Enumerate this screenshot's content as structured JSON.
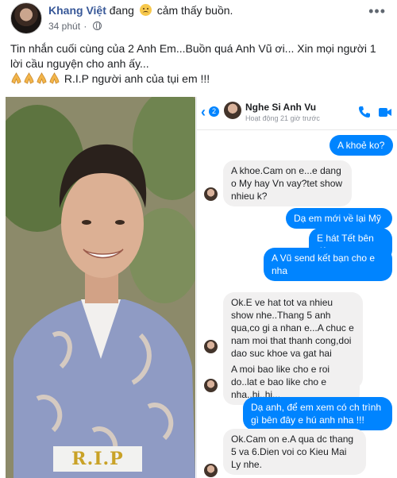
{
  "post": {
    "author": "Khang Việt",
    "feeling_prefix": "đang",
    "feeling": "cảm thấy buồn.",
    "time": "34 phút",
    "more_label": "•••",
    "text_line1": "Tin nhắn cuối cùng của 2 Anh Em...Buồn quá Anh Vũ ơi... Xin mọi người 1 lời cầu nguyện cho anh ấy...",
    "text_line2": "R.I.P người anh của tụi em !!!"
  },
  "photo": {
    "rip_label": "R.I.P"
  },
  "chat": {
    "back_count": "2",
    "contact_name": "Nghe Si Anh Vu",
    "contact_status": "Hoạt động 21 giờ trước",
    "messages": [
      {
        "dir": "out",
        "text": "A khoẻ ko?"
      },
      {
        "dir": "in",
        "text": "A khoe.Cam on e...e dang o My hay Vn vay?tet show nhieu k?"
      },
      {
        "dir": "out",
        "text": "Dạ em mới về lại Mỹ"
      },
      {
        "dir": "out",
        "text": "E hát Tết bên đây"
      },
      {
        "dir": "out",
        "text": "A Vũ send kết bạn cho e nha"
      },
      {
        "dir": "in",
        "text": "Ok.E ve hat tot va nhieu show nhe..Thang 5 anh qua,co gi a nhan e...A chuc e nam moi that thanh cong,doi dao suc khoe va gat hai duoc hanh phuc cho rieng minh:)"
      },
      {
        "dir": "in",
        "text": "A moi bao like cho e roi do..lat e bao like cho e nha..hi..hi..."
      },
      {
        "dir": "out",
        "text": "Dạ anh, để em xem có ch trình gì bên đây e hú anh nha !!!"
      },
      {
        "dir": "in",
        "text": "Ok.Cam on e.A qua dc thang 5 va 6.Dien voi co Kieu Mai Ly nhe."
      }
    ]
  },
  "colors": {
    "messenger_blue": "#0084ff",
    "incoming_bubble": "#f1f0f0",
    "author_link": "#385898"
  }
}
